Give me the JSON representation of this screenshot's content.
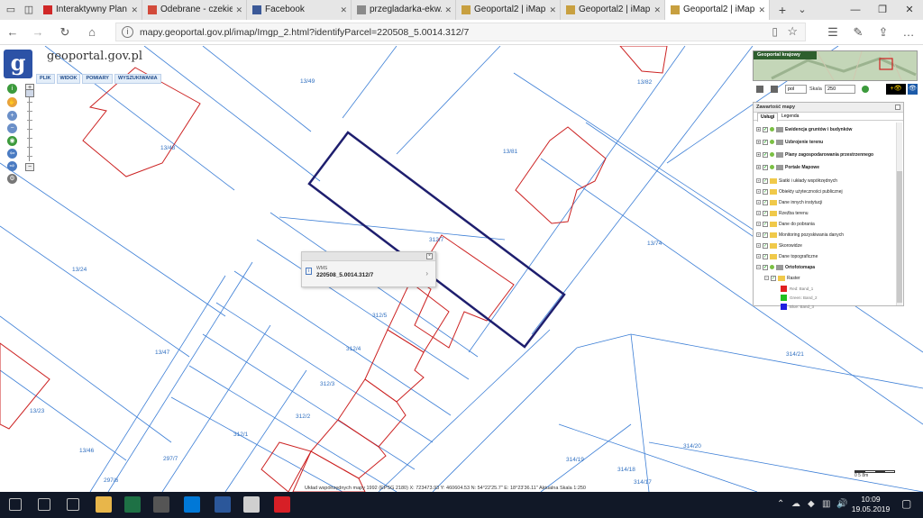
{
  "browser": {
    "tabs": [
      {
        "title": "Interaktywny Plan Gdań",
        "favicon_color": "#d02828",
        "active": false
      },
      {
        "title": "Odebrane - czekiel.ursz",
        "favicon_color": "#d24a3a",
        "active": false
      },
      {
        "title": "Facebook",
        "favicon_color": "#3b5998",
        "active": false
      },
      {
        "title": "przegladarka-ekw.ms.g",
        "favicon_color": "#8a8a8a",
        "active": false
      },
      {
        "title": "Geoportal2 | iMap",
        "favicon_color": "#c8a040",
        "active": false
      },
      {
        "title": "Geoportal2 | iMap",
        "favicon_color": "#c8a040",
        "active": false
      },
      {
        "title": "Geoportal2 | iMap",
        "favicon_color": "#c8a040",
        "active": true
      }
    ],
    "new_tab": "+",
    "tab_menu": "⌄",
    "close_glyph": "✕",
    "url": "mapy.geoportal.gov.pl/imap/Imgp_2.html?identifyParcel=220508_5.0014.312/7",
    "icons": [
      "back-icon",
      "forward-icon",
      "refresh-icon",
      "home-icon",
      "reading-view-icon",
      "favorite-star-icon",
      "favorites-icon",
      "notes-icon",
      "share-icon",
      "more-icon"
    ]
  },
  "app": {
    "logo_letter": "g",
    "brand": "geoportal.gov.pl",
    "menu": [
      "PLIK",
      "WIDOK",
      "POMIARY",
      "WYSZUKIWANIA"
    ]
  },
  "map": {
    "parcel_labels": [
      {
        "text": "13/49"
      },
      {
        "text": "13/82"
      },
      {
        "text": "13/48"
      },
      {
        "text": "13/81"
      },
      {
        "text": "13/24"
      },
      {
        "text": "13/74"
      },
      {
        "text": "13/47"
      },
      {
        "text": "314/21"
      },
      {
        "text": "13/23"
      },
      {
        "text": "13/46"
      },
      {
        "text": "297/7"
      },
      {
        "text": "297/6"
      },
      {
        "text": "312/1"
      },
      {
        "text": "312/2"
      },
      {
        "text": "312/3"
      },
      {
        "text": "312/4"
      },
      {
        "text": "312/5"
      },
      {
        "text": "312/7"
      },
      {
        "text": "314/19"
      },
      {
        "text": "314/18"
      },
      {
        "text": "314/17"
      },
      {
        "text": "314/20"
      }
    ]
  },
  "popup": {
    "label": "WMS",
    "value": "220508_5.0014.312/7",
    "close": "×",
    "arrow": "›"
  },
  "right_panel": {
    "overview_title": "Geoportal krajowy",
    "language": "pol",
    "scale_label": "Skala",
    "scale_value": "250",
    "content_title": "Zawartość mapy",
    "tabs": [
      "Usługi",
      "Legenda"
    ],
    "layers": [
      {
        "name": "Ewidencja gruntów i budynków",
        "bold": true,
        "kind": "service"
      },
      {
        "name": "Uzbrojenie terenu",
        "bold": true,
        "kind": "service"
      },
      {
        "name": "Plany zagospodarowania przestrzennego",
        "bold": true,
        "kind": "service"
      },
      {
        "name": "Portale Mapowe",
        "bold": true,
        "kind": "service"
      },
      {
        "name": "Siatki i układy współrzędnych",
        "bold": false,
        "kind": "folder"
      },
      {
        "name": "Obiekty użyteczności publicznej",
        "bold": false,
        "kind": "folder"
      },
      {
        "name": "Dane innych instytucji",
        "bold": false,
        "kind": "folder"
      },
      {
        "name": "Rzeźba terenu",
        "bold": false,
        "kind": "folder"
      },
      {
        "name": "Dane do pobrania",
        "bold": false,
        "kind": "folder"
      },
      {
        "name": "Monitoring pozyskiwania danych",
        "bold": false,
        "kind": "folder"
      },
      {
        "name": "Skorowidze",
        "bold": false,
        "kind": "folder"
      },
      {
        "name": "Dane topograficzne",
        "bold": false,
        "kind": "folder"
      },
      {
        "name": "Ortofotomapa",
        "bold": true,
        "kind": "service"
      },
      {
        "name": "Raster",
        "bold": false,
        "kind": "folder"
      }
    ],
    "bands": [
      {
        "name": "Red: Band_1",
        "color": "#e02020"
      },
      {
        "name": "Green: Band_2",
        "color": "#20c020"
      },
      {
        "name": "Blue: Band_3",
        "color": "#2020e0"
      }
    ]
  },
  "status": {
    "coords": "Układ współrzędnych mapy 1992 (EPSG 2180)   X: 723473.93  Y: 460604.53   N: 54°22'25.7\"  E: 18°23'36.11\"   Aktualna Skala 1:250",
    "scale_rule": "0     5     8m"
  },
  "taskbar": {
    "time": "10:09",
    "date": "19.05.2019",
    "apps": [
      "start-icon",
      "search-icon",
      "task-view-icon",
      "file-explorer-icon",
      "excel-icon",
      "calculator-icon",
      "edge-icon",
      "word-icon",
      "photos-icon",
      "acrobat-icon"
    ]
  },
  "colors": {
    "parcel_line": "#3d7fd6",
    "building_line": "#cc2222",
    "selected_parcel": "#1e1e6e",
    "accent": "#2c52a6"
  }
}
